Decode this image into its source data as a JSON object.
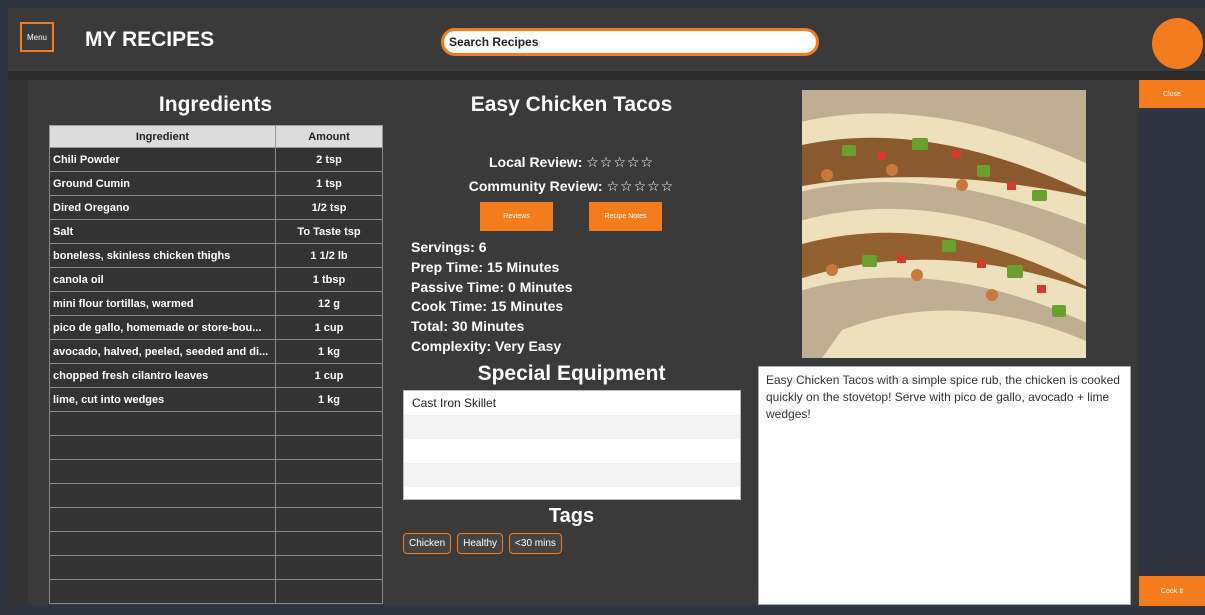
{
  "header": {
    "menu_label": "Menu",
    "app_title": "MY RECIPES",
    "search_placeholder": "Search Recipes"
  },
  "actions": {
    "close_label": "Close",
    "cook_label": "Cook It"
  },
  "ingredients": {
    "heading": "Ingredients",
    "columns": [
      "Ingredient",
      "Amount"
    ],
    "rows": [
      {
        "name": "Chili Powder",
        "amount": "2 tsp"
      },
      {
        "name": "Ground Cumin",
        "amount": "1 tsp"
      },
      {
        "name": "Dired Oregano",
        "amount": "1/2 tsp"
      },
      {
        "name": "Salt",
        "amount": "To Taste tsp"
      },
      {
        "name": "boneless, skinless chicken thighs",
        "amount": "1 1/2 lb"
      },
      {
        "name": "canola oil",
        "amount": "1 tbsp"
      },
      {
        "name": "mini flour tortillas, warmed",
        "amount": "12 g"
      },
      {
        "name": "pico de gallo, homemade or store-bou...",
        "amount": "1 cup"
      },
      {
        "name": "avocado, halved, peeled, seeded and di...",
        "amount": "1 kg"
      },
      {
        "name": "chopped fresh cilantro leaves",
        "amount": "1 cup"
      },
      {
        "name": "lime, cut into wedges",
        "amount": "1 kg"
      },
      {
        "name": "",
        "amount": ""
      },
      {
        "name": "",
        "amount": ""
      },
      {
        "name": "",
        "amount": ""
      },
      {
        "name": "",
        "amount": ""
      },
      {
        "name": "",
        "amount": ""
      },
      {
        "name": "",
        "amount": ""
      },
      {
        "name": "",
        "amount": ""
      },
      {
        "name": "",
        "amount": ""
      }
    ]
  },
  "recipe": {
    "title": "Easy Chicken Tacos",
    "local_review_label": "Local Review:",
    "local_review_stars": "☆☆☆☆☆",
    "community_review_label": "Community Review:",
    "community_review_stars": "☆☆☆☆☆",
    "reviews_button": "Reviews",
    "notes_button": "Recipe Notes",
    "servings": "Servings: 6",
    "prep_time": "Prep Time: 15 Minutes",
    "passive_time": "Passive Time: 0 Minutes",
    "cook_time": "Cook Time: 15 Minutes",
    "total": "Total: 30 Minutes",
    "complexity": "Complexity: Very Easy",
    "description": "Easy Chicken Tacos with a simple spice rub, the chicken is cooked quickly on the stovetop! Serve with pico de gallo, avocado + lime wedges!"
  },
  "equipment": {
    "heading": "Special Equipment",
    "items": [
      "Cast Iron Skillet",
      "",
      "",
      ""
    ]
  },
  "tags": {
    "heading": "Tags",
    "items": [
      "Chicken",
      "Healthy",
      "<30 mins"
    ]
  },
  "colors": {
    "accent": "#f47c1c",
    "panel": "#3a3a3a",
    "background": "#2f3540"
  }
}
